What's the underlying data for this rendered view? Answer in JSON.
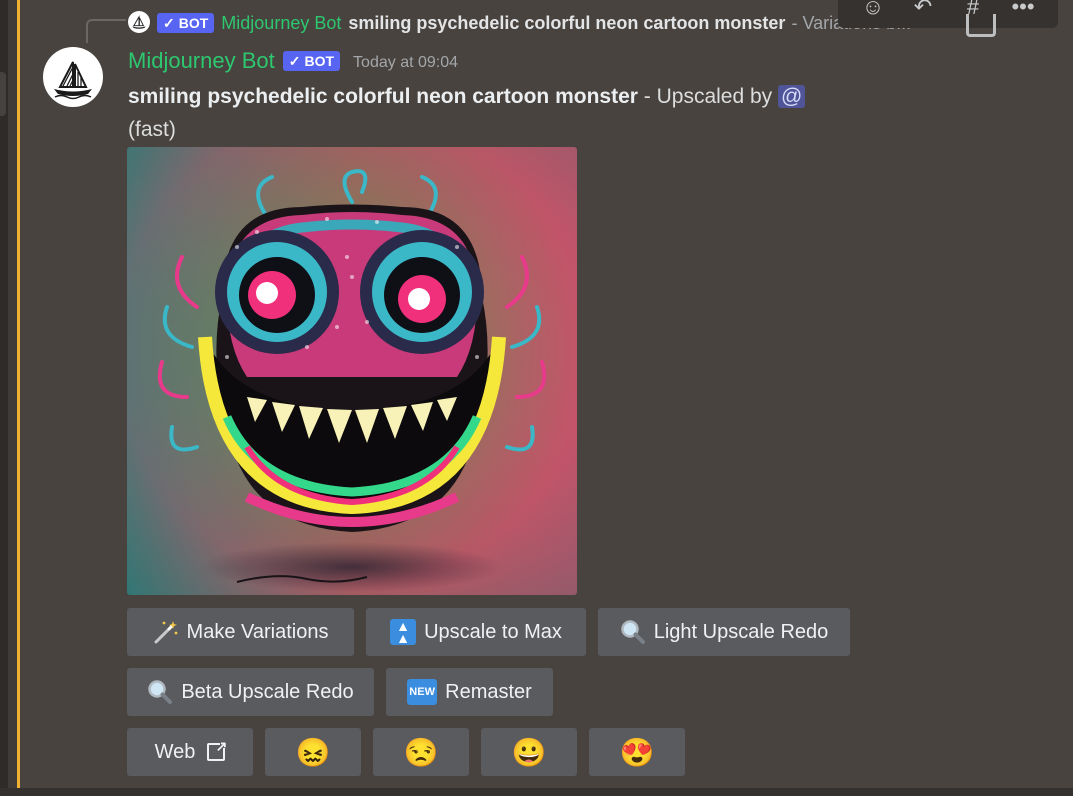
{
  "reply": {
    "badge": "BOT",
    "author": "Midjourney Bot",
    "prompt": "smiling psychedelic colorful neon cartoon monster",
    "suffix": "- Variations b..."
  },
  "message": {
    "author": "Midjourney Bot",
    "badge": "BOT",
    "timestamp": "Today at 09:04",
    "prompt": "smiling psychedelic colorful neon cartoon monster",
    "status": "- Upscaled by",
    "mention": "@",
    "mode": "(fast)"
  },
  "toolbar": {
    "icons": [
      "add-reaction-icon",
      "reply-icon",
      "create-thread-icon",
      "more-icon"
    ],
    "more": "•••"
  },
  "buttons": {
    "make_variations": "Make Variations",
    "upscale_to_max": "Upscale to Max",
    "light_upscale_redo": "Light Upscale Redo",
    "beta_upscale_redo": "Beta Upscale Redo",
    "remaster": "Remaster",
    "new_icon": "NEW",
    "web": "Web"
  },
  "reactions": [
    "😖",
    "😒",
    "😀",
    "😍"
  ],
  "colors": {
    "accent": "#f0b132",
    "bot_badge": "#5865f2",
    "username": "#2dc770",
    "button_bg": "#595b5f",
    "message_bg": "#48433e"
  }
}
